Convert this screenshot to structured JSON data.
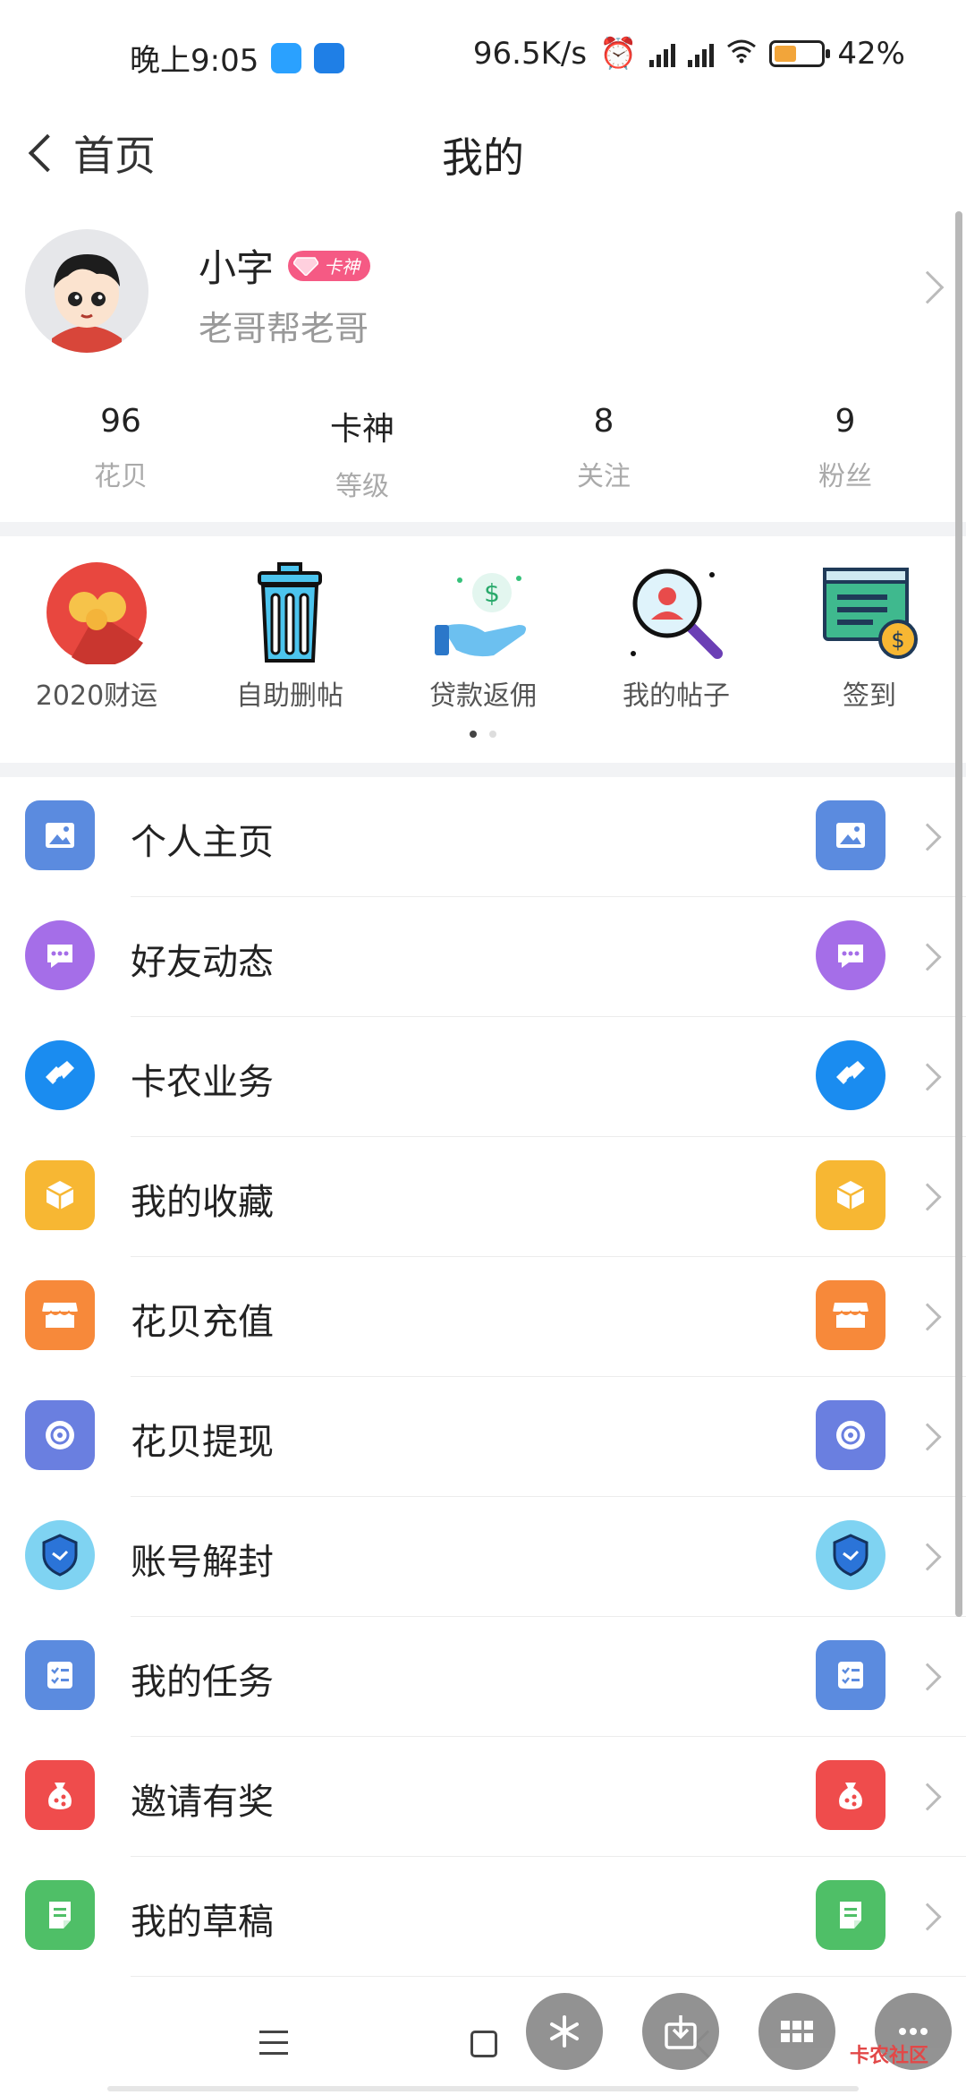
{
  "status_bar": {
    "time": "晚上9:05",
    "speed": "96.5K/s",
    "battery": "42%",
    "battery_level": 0.42
  },
  "header": {
    "back_label": "首页",
    "title": "我的"
  },
  "profile": {
    "name": "小字",
    "badge": "卡神",
    "subtitle": "老哥帮老哥"
  },
  "stats": [
    {
      "value": "96",
      "label": "花贝"
    },
    {
      "value": "卡神",
      "label": "等级"
    },
    {
      "value": "8",
      "label": "关注"
    },
    {
      "value": "9",
      "label": "粉丝"
    }
  ],
  "quick_actions": [
    {
      "label": "2020财运",
      "icon": "fortune-icon"
    },
    {
      "label": "自助删帖",
      "icon": "trash-icon"
    },
    {
      "label": "贷款返佣",
      "icon": "money-hand-icon"
    },
    {
      "label": "我的帖子",
      "icon": "search-user-icon"
    },
    {
      "label": "签到",
      "icon": "checkin-icon"
    }
  ],
  "menu": [
    {
      "label": "个人主页",
      "icon": "image-icon",
      "color": "#5b8bdf"
    },
    {
      "label": "好友动态",
      "icon": "chat-icon",
      "color": "#a56ee8"
    },
    {
      "label": "卡农业务",
      "icon": "handshake-icon",
      "color": "#1a8cf0"
    },
    {
      "label": "我的收藏",
      "icon": "box-icon",
      "color": "#f7b733"
    },
    {
      "label": "花贝充值",
      "icon": "store-icon",
      "color": "#f7893a"
    },
    {
      "label": "花贝提现",
      "icon": "coin-icon",
      "color": "#6a7fe0"
    },
    {
      "label": "账号解封",
      "icon": "shield-icon",
      "color": "#2b74d8"
    },
    {
      "label": "我的任务",
      "icon": "task-icon",
      "color": "#5b8bdf"
    },
    {
      "label": "邀请有奖",
      "icon": "gift-bag-icon",
      "color": "#ef4c4c"
    },
    {
      "label": "我的草稿",
      "icon": "draft-icon",
      "color": "#4fbf67"
    }
  ],
  "watermark": "卡农社区"
}
